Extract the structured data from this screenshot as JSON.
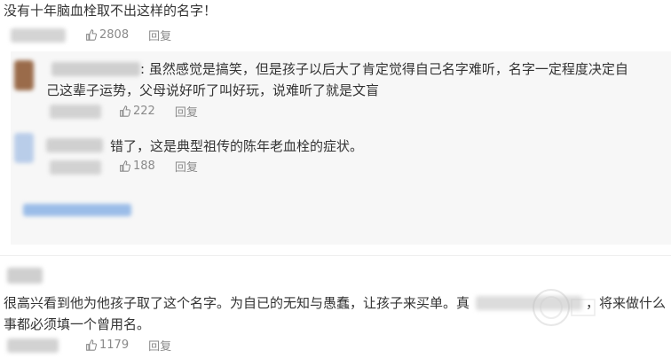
{
  "comments": [
    {
      "text": "没有十年脑血栓取不出这样的名字！",
      "likes": "2808",
      "reply_label": "回复"
    }
  ],
  "replies": [
    {
      "text_line1": ": 虽然感觉是搞笑，但是孩子以后大了肯定觉得自己名字难听，名字一定程度决定自",
      "text_line2": "己这辈子运势，父母说好听了叫好玩，说难听了就是文盲",
      "likes": "222",
      "reply_label": "回复"
    },
    {
      "text_line1": "错了，这是典型祖传的陈年老血栓的症状。",
      "likes": "188",
      "reply_label": "回复"
    }
  ],
  "second_comment": {
    "text_line1": "很高兴看到他为他孩子取了这个名字。为自已的无知与愚蠢，让孩子来买单。真",
    "text_line1_tail": "，将来做什么",
    "text_line2": "事都必须填一个曾用名。",
    "likes": "1179",
    "reply_label": "回复"
  },
  "colors": {
    "text": "#333333",
    "meta": "#8a8a8a",
    "reply_bg": "#f7f7f7",
    "blur_blue": "#9bbde8",
    "blur_gray": "#c8c8c8"
  },
  "icons": {
    "like": "thumbs-up-icon"
  }
}
